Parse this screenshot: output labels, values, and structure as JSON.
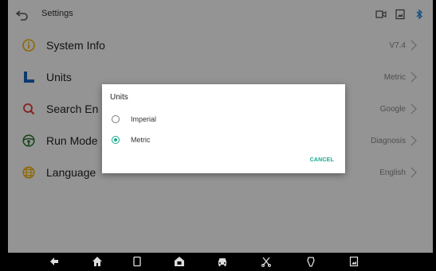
{
  "header": {
    "title": "Settings"
  },
  "rows": [
    {
      "label": "System Info",
      "value": "V7.4",
      "icon": "info-icon",
      "color": "#f5b300"
    },
    {
      "label": "Units",
      "value": "Metric",
      "icon": "units-icon",
      "color": "#1565c0"
    },
    {
      "label": "Search En",
      "value": "Google",
      "icon": "search-icon",
      "color": "#e53935"
    },
    {
      "label": "Run Mode",
      "value": "Diagnosis",
      "icon": "steering-wheel-icon",
      "color": "#2e7d32"
    },
    {
      "label": "Language",
      "value": "English",
      "icon": "globe-icon",
      "color": "#f5b300"
    }
  ],
  "dialog": {
    "title": "Units",
    "options": [
      {
        "label": "Imperial",
        "selected": false
      },
      {
        "label": "Metric",
        "selected": true
      }
    ],
    "cancel_label": "CANCEL"
  },
  "colors": {
    "accent": "#16a98e",
    "dim_overlay": "rgba(0,0,0,0.42)"
  },
  "navbar": {
    "icons": [
      "back-icon",
      "home-icon",
      "recent-apps-icon",
      "diagnostics-home-icon",
      "vehicle-icon",
      "tools-icon",
      "vci-icon",
      "screenshot-icon"
    ]
  }
}
